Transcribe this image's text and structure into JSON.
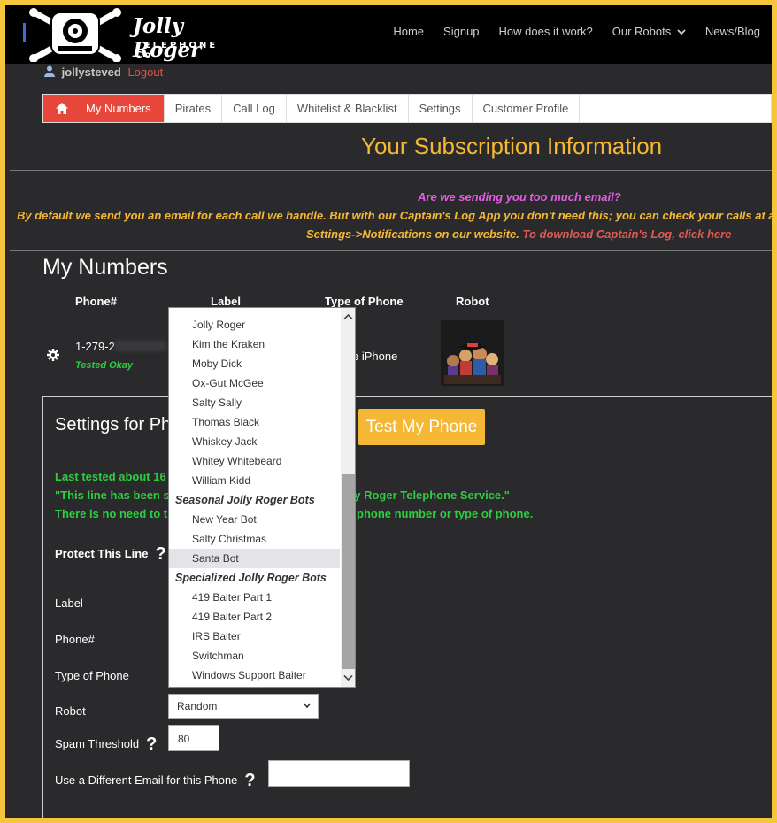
{
  "header": {
    "logo_script": "Jolly Roger",
    "logo_sub": "TELEPHONE Co",
    "nav": [
      "Home",
      "Signup",
      "How does it work?",
      "Our Robots",
      "News/Blog"
    ]
  },
  "user": {
    "name": "jollysteved",
    "logout": "Logout"
  },
  "tabs": [
    "My Numbers",
    "Pirates",
    "Call Log",
    "Whitelist & Blacklist",
    "Settings",
    "Customer Profile"
  ],
  "subscription_title": "Your Subscription Information",
  "notice": {
    "line1": "Are we sending you too much email?",
    "line2": "By default we send you an email for each call we handle. But with our Captain's Log App you don't need this; you can check your calls at a",
    "line3": "Settings->Notifications on our website.",
    "line3_link": "To download Captain's Log, click here"
  },
  "my_numbers": {
    "title": "My Numbers",
    "headers": [
      "Phone#",
      "Label",
      "Type of Phone",
      "Robot"
    ],
    "row": {
      "phone": "1-279-2",
      "status": "Tested Okay",
      "phone_type": "e iPhone"
    }
  },
  "settings": {
    "title": "Settings for Ph",
    "test_button": "Test My Phone",
    "last_tested": "Last tested about 16",
    "line_status_left": "\"This line has been s",
    "line_status_right": "lly Roger Telephone Service.\"",
    "no_need_left": "There is no need to t",
    "no_need_right": "phone number or type of phone.",
    "protect_label": "Protect This Line",
    "label_label": "Label",
    "phone_label": "Phone#",
    "type_label": "Type of Phone",
    "robot_label": "Robot",
    "robot_value": "Random",
    "spam_label": "Spam Threshold",
    "spam_value": "80",
    "email_label": "Use a Different Email for this Phone"
  },
  "dropdown": {
    "items": [
      {
        "kind": "opt",
        "label": "Jolly Roger"
      },
      {
        "kind": "opt",
        "label": "Kim the Kraken"
      },
      {
        "kind": "opt",
        "label": "Moby Dick"
      },
      {
        "kind": "opt",
        "label": "Ox-Gut McGee"
      },
      {
        "kind": "opt",
        "label": "Salty Sally"
      },
      {
        "kind": "opt",
        "label": "Thomas Black"
      },
      {
        "kind": "opt",
        "label": "Whiskey Jack"
      },
      {
        "kind": "opt",
        "label": "Whitey Whitebeard"
      },
      {
        "kind": "opt",
        "label": "William Kidd"
      },
      {
        "kind": "group",
        "label": "Seasonal Jolly Roger Bots"
      },
      {
        "kind": "opt",
        "label": "New Year Bot"
      },
      {
        "kind": "opt",
        "label": "Salty Christmas"
      },
      {
        "kind": "opt",
        "label": "Santa Bot",
        "highlighted": true
      },
      {
        "kind": "group",
        "label": "Specialized Jolly Roger Bots"
      },
      {
        "kind": "opt",
        "label": "419 Baiter Part 1"
      },
      {
        "kind": "opt",
        "label": "419 Baiter Part 2"
      },
      {
        "kind": "opt",
        "label": "IRS Baiter"
      },
      {
        "kind": "opt",
        "label": "Switchman"
      },
      {
        "kind": "opt",
        "label": "Windows Support Baiter"
      }
    ]
  },
  "colors": {
    "frame": "#f5c53b",
    "background": "#2a2a2c",
    "accent_red": "#e7473a",
    "gold": "#f5b835",
    "green": "#2ecc40",
    "magenta": "#e65be6"
  },
  "icons": [
    "home-icon",
    "user-icon",
    "gear-icon",
    "help-icon",
    "chevron-down-icon",
    "skull-logo-icon"
  ]
}
